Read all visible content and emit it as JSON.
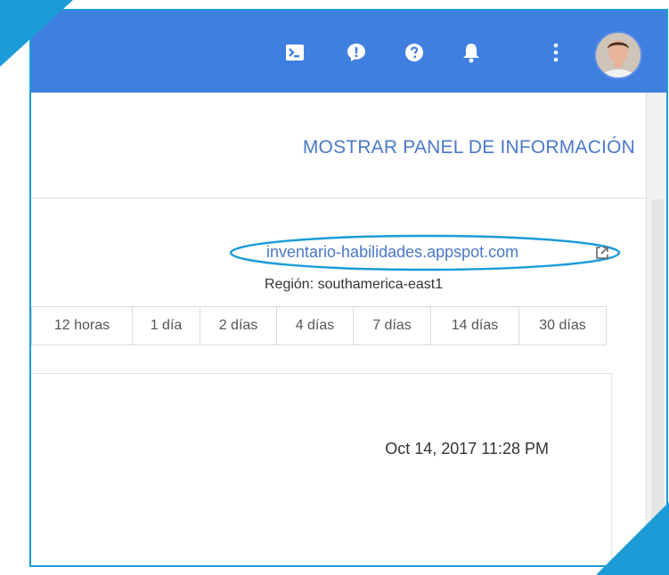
{
  "appbar": {
    "icons": [
      "terminal-icon",
      "feedback-icon",
      "help-icon",
      "notifications-icon",
      "more-vert-icon"
    ],
    "colors": {
      "bar": "#3f7fe0",
      "frame": "#1a9cd8"
    }
  },
  "info_panel": {
    "toggle_label": "MOSTRAR PANEL DE INFORMACIÓN"
  },
  "app": {
    "url": "inventario-habilidades.appspot.com",
    "region": "Región: southamerica-east1"
  },
  "time_ranges": [
    "12 horas",
    "1 día",
    "2 días",
    "4 días",
    "7 días",
    "14 días",
    "30 días"
  ],
  "card": {
    "timestamp": "Oct 14, 2017 11:28 PM"
  }
}
